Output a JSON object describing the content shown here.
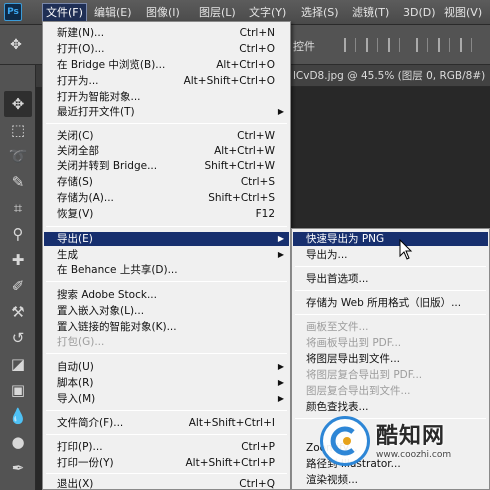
{
  "menubar": {
    "logo": "Ps",
    "items": [
      "文件(F)",
      "编辑(E)",
      "图像(I)",
      "图层(L)",
      "文字(Y)",
      "选择(S)",
      "滤镜(T)",
      "3D(D)",
      "视图(V)"
    ]
  },
  "options_bar": {
    "label": "控件"
  },
  "document_tab": {
    "title": "lCvD8.jpg @ 45.5% (图层 0, RGB/8#)"
  },
  "file_menu": {
    "items": [
      {
        "label": "新建(N)...",
        "shortcut": "Ctrl+N"
      },
      {
        "label": "打开(O)...",
        "shortcut": "Ctrl+O"
      },
      {
        "label": "在 Bridge 中浏览(B)...",
        "shortcut": "Alt+Ctrl+O"
      },
      {
        "label": "打开为...",
        "shortcut": "Alt+Shift+Ctrl+O"
      },
      {
        "label": "打开为智能对象...",
        "shortcut": ""
      },
      {
        "label": "最近打开文件(T)",
        "shortcut": "",
        "submenu": true
      },
      {
        "label": "关闭(C)",
        "shortcut": "Ctrl+W"
      },
      {
        "label": "关闭全部",
        "shortcut": "Alt+Ctrl+W"
      },
      {
        "label": "关闭并转到 Bridge...",
        "shortcut": "Shift+Ctrl+W"
      },
      {
        "label": "存储(S)",
        "shortcut": "Ctrl+S"
      },
      {
        "label": "存储为(A)...",
        "shortcut": "Shift+Ctrl+S"
      },
      {
        "label": "恢复(V)",
        "shortcut": "F12"
      },
      {
        "label": "导出(E)",
        "shortcut": "",
        "submenu": true,
        "highlighted": true
      },
      {
        "label": "生成",
        "shortcut": "",
        "submenu": true
      },
      {
        "label": "在 Behance 上共享(D)...",
        "shortcut": ""
      },
      {
        "label": "搜索 Adobe Stock...",
        "shortcut": ""
      },
      {
        "label": "置入嵌入对象(L)...",
        "shortcut": ""
      },
      {
        "label": "置入链接的智能对象(K)...",
        "shortcut": ""
      },
      {
        "label": "打包(G)...",
        "shortcut": "",
        "disabled": true
      },
      {
        "label": "自动(U)",
        "shortcut": "",
        "submenu": true
      },
      {
        "label": "脚本(R)",
        "shortcut": "",
        "submenu": true
      },
      {
        "label": "导入(M)",
        "shortcut": "",
        "submenu": true
      },
      {
        "label": "文件简介(F)...",
        "shortcut": "Alt+Shift+Ctrl+I"
      },
      {
        "label": "打印(P)...",
        "shortcut": "Ctrl+P"
      },
      {
        "label": "打印一份(Y)",
        "shortcut": "Alt+Shift+Ctrl+P"
      },
      {
        "label": "退出(X)",
        "shortcut": "Ctrl+Q"
      }
    ]
  },
  "export_submenu": {
    "items": [
      {
        "label": "快速导出为 PNG",
        "highlighted": true
      },
      {
        "label": "导出为..."
      },
      {
        "label": "导出首选项..."
      },
      {
        "label": "存储为 Web 所用格式（旧版）..."
      },
      {
        "label": "画板至文件...",
        "disabled": true
      },
      {
        "label": "将画板导出到 PDF...",
        "disabled": true
      },
      {
        "label": "将图层导出到文件..."
      },
      {
        "label": "将图层复合导出到 PDF...",
        "disabled": true
      },
      {
        "label": "图层复合导出到文件...",
        "disabled": true
      },
      {
        "label": "颜色查找表..."
      },
      {
        "label": "Zoomify..."
      },
      {
        "label": "路径到 Illustrator..."
      },
      {
        "label": "渲染视频..."
      }
    ]
  },
  "watermark": {
    "brand": "酷知网",
    "url": "www.coozhi.com"
  },
  "colors": {
    "highlight": "#172f6e",
    "menu_bg": "#f0f0f0",
    "app_bg": "#535353",
    "accent": "#2d86d6"
  }
}
